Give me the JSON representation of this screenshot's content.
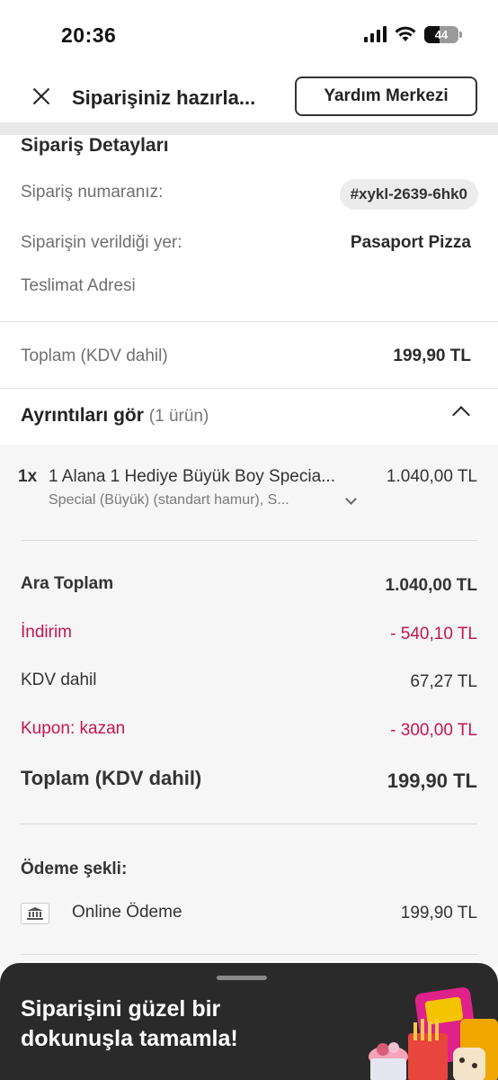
{
  "status_bar": {
    "time": "20:36",
    "battery": "44",
    "battery_level": 0.44
  },
  "header": {
    "title": "Siparişiniz hazırla...",
    "help_button": "Yardım Merkezi"
  },
  "order_details": {
    "title": "Sipariş Detayları",
    "order_number_label": "Sipariş numaranız:",
    "order_number": "#xykl-2639-6hk0",
    "restaurant_label": "Siparişin verildiği yer:",
    "restaurant": "Pasaport Pizza",
    "address_label": "Teslimat Adresi",
    "total_label": "Toplam (KDV dahil)",
    "total_value": "199,90 TL"
  },
  "details": {
    "toggle_label": "Ayrıntıları gör",
    "item_count": "(1 ürün)",
    "items": [
      {
        "qty": "1x",
        "name": "1 Alana 1 Hediye Büyük Boy Specia...",
        "price": "1.040,00 TL",
        "description": "Special (Büyük) (standart hamur), S..."
      }
    ]
  },
  "summary": {
    "subtotal_label": "Ara Toplam",
    "subtotal_value": "1.040,00 TL",
    "discount_label": "İndirim",
    "discount_value": "- 540,10 TL",
    "vat_label": "KDV dahil",
    "vat_value": "67,27 TL",
    "coupon_label": "Kupon: kazan",
    "coupon_value": "- 300,00 TL",
    "total_label": "Toplam (KDV dahil)",
    "total_value": "199,90 TL"
  },
  "payment": {
    "title": "Ödeme şekli:",
    "method": "Online Ödeme",
    "amount": "199,90 TL"
  },
  "promo_sheet": {
    "text": "Siparişini güzel bir dokunuşla tamamla!"
  },
  "colors": {
    "accent_red": "#c4154f",
    "sheet_bg": "#2a2a2a",
    "divider": "#e9e9e9"
  }
}
